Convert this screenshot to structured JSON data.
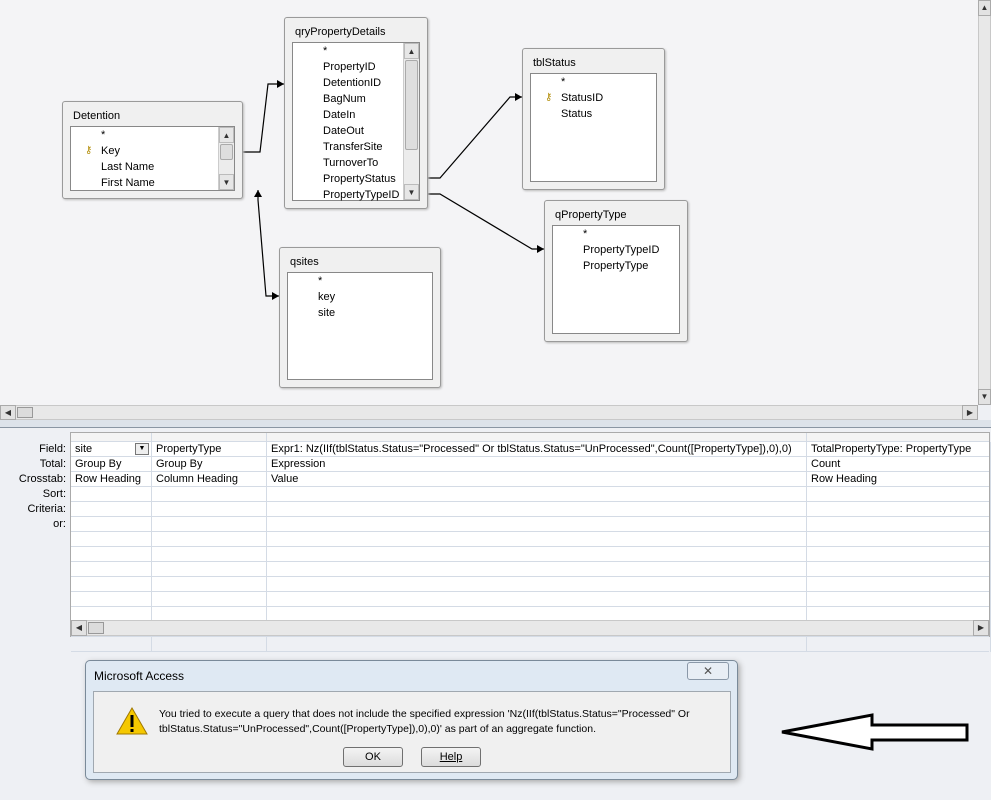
{
  "tables": [
    {
      "name": "Detention",
      "fields": [
        "*",
        "Key",
        "Last Name",
        "First Name"
      ],
      "key": "Key"
    },
    {
      "name": "qryPropertyDetails",
      "fields": [
        "*",
        "PropertyID",
        "DetentionID",
        "BagNum",
        "DateIn",
        "DateOut",
        "TransferSite",
        "TurnoverTo",
        "PropertyStatus",
        "PropertyTypeID"
      ]
    },
    {
      "name": "tblStatus",
      "fields": [
        "*",
        "StatusID",
        "Status"
      ],
      "key": "StatusID"
    },
    {
      "name": "qPropertyType",
      "fields": [
        "*",
        "PropertyTypeID",
        "PropertyType"
      ]
    },
    {
      "name": "qsites",
      "fields": [
        "*",
        "key",
        "site"
      ]
    }
  ],
  "grid": {
    "row_labels": [
      "Field:",
      "Total:",
      "Crosstab:",
      "Sort:",
      "Criteria:",
      "or:"
    ],
    "columns": [
      {
        "field": "site",
        "total": "Group By",
        "crosstab": "Row Heading"
      },
      {
        "field": "PropertyType",
        "total": "Group By",
        "crosstab": "Column Heading"
      },
      {
        "field": "Expr1: Nz(IIf(tblStatus.Status=\"Processed\" Or tblStatus.Status=\"UnProcessed\",Count([PropertyType]),0),0)",
        "total": "Expression",
        "crosstab": "Value"
      },
      {
        "field": "TotalPropertyType: PropertyType",
        "total": "Count",
        "crosstab": "Row Heading"
      }
    ]
  },
  "dialog": {
    "title": "Microsoft Access",
    "message_line1": "You tried to execute a query that does not include the specified expression 'Nz(IIf(tblStatus.Status=\"Processed\" Or",
    "message_line2": "tblStatus.Status=\"UnProcessed\",Count([PropertyType]),0),0)' as part of an aggregate function.",
    "ok": "OK",
    "help": "Help"
  }
}
